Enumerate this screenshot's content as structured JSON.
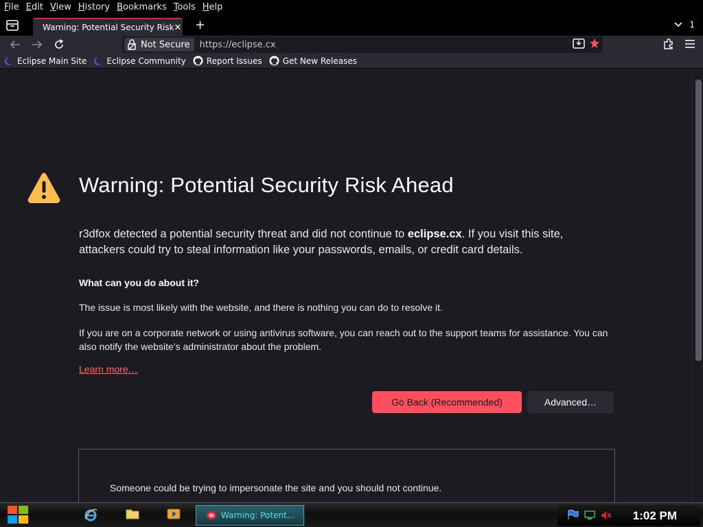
{
  "menubar": {
    "items": [
      {
        "accel": "F",
        "rest": "ile"
      },
      {
        "accel": "E",
        "rest": "dit"
      },
      {
        "accel": "V",
        "rest": "iew"
      },
      {
        "accel": "H",
        "rest": "istory"
      },
      {
        "accel": "B",
        "rest": "ookmarks"
      },
      {
        "accel": "T",
        "rest": "ools"
      },
      {
        "accel": "H",
        "rest": "elp"
      }
    ]
  },
  "tabs": {
    "active_title": "Warning: Potential Security Risk",
    "close_glyph": "✕",
    "new_tab_glyph": "+",
    "count": "1"
  },
  "navbar": {
    "security_label": "Not Secure",
    "url": "https://eclipse.cx"
  },
  "bookmarks": [
    {
      "label": "Eclipse Main Site",
      "icon": "eclipse-icon"
    },
    {
      "label": "Eclipse Community",
      "icon": "eclipse-icon"
    },
    {
      "label": "Report Issues",
      "icon": "github-icon"
    },
    {
      "label": "Get New Releases",
      "icon": "github-icon"
    }
  ],
  "page": {
    "title": "Warning: Potential Security Risk Ahead",
    "desc_before": "r3dfox detected a potential security threat and did not continue to ",
    "desc_domain": "eclipse.cx",
    "desc_after": ". If you visit this site, attackers could try to steal information like your passwords, emails, or credit card details.",
    "subhead": "What can you do about it?",
    "p1": "The issue is most likely with the website, and there is nothing you can do to resolve it.",
    "p2": "If you are on a corporate network or using antivirus software, you can reach out to the support teams for assistance. You can also notify the website’s administrator about the problem.",
    "learn_more": "Learn more…",
    "go_back": "Go Back (Recommended)",
    "advanced": "Advanced…",
    "advanced_text": "Someone could be trying to impersonate the site and you should not continue."
  },
  "taskbar": {
    "task_label": "Warning: Potent...",
    "clock": "1:02 PM"
  },
  "colors": {
    "accent": "#ff4f5e",
    "tab_indicator": "#e0223f",
    "warning_yellow": "#ffbd4f"
  }
}
